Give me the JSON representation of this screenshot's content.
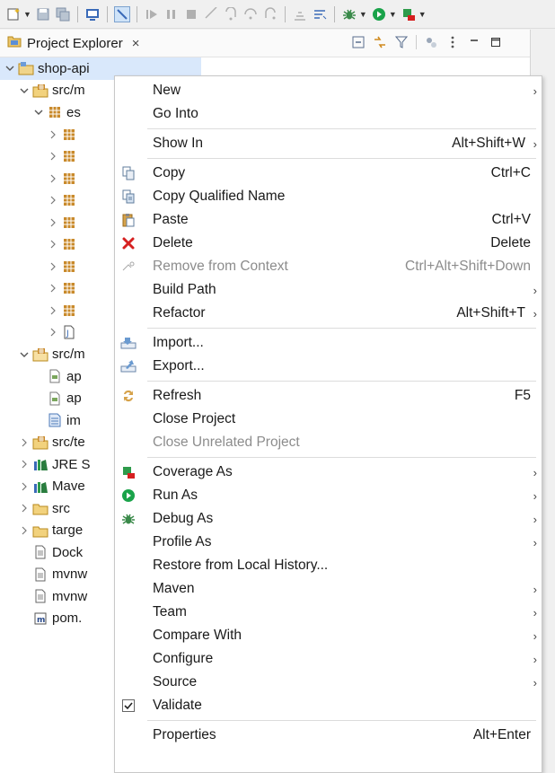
{
  "toolbar": {
    "icons": [
      "new-icon",
      "save-icon",
      "save-all-icon",
      "console-icon",
      "skip-breakpoints-icon",
      "resume-icon",
      "suspend-icon",
      "terminate-icon",
      "disconnect-icon",
      "step-into-icon",
      "step-over-icon",
      "step-return-icon",
      "drop-to-frame-icon",
      "use-step-filters-icon",
      "debug-icon",
      "run-icon",
      "coverage-icon"
    ]
  },
  "view": {
    "title": "Project Explorer",
    "close": "×"
  },
  "tree": [
    {
      "label": "shop-api",
      "twisty": "v",
      "icon": "project-icon",
      "indent": 0
    },
    {
      "label": "src/m",
      "twisty": "v",
      "icon": "source-folder-icon",
      "indent": 1
    },
    {
      "label": "es",
      "twisty": "v",
      "icon": "package-icon",
      "indent": 2
    },
    {
      "label": "",
      "twisty": ">",
      "icon": "package-icon",
      "indent": 3
    },
    {
      "label": "",
      "twisty": ">",
      "icon": "package-icon",
      "indent": 3
    },
    {
      "label": "",
      "twisty": ">",
      "icon": "package-icon",
      "indent": 3
    },
    {
      "label": "",
      "twisty": ">",
      "icon": "package-icon",
      "indent": 3
    },
    {
      "label": "",
      "twisty": ">",
      "icon": "package-icon",
      "indent": 3
    },
    {
      "label": "",
      "twisty": ">",
      "icon": "package-icon",
      "indent": 3
    },
    {
      "label": "",
      "twisty": ">",
      "icon": "package-icon",
      "indent": 3
    },
    {
      "label": "",
      "twisty": ">",
      "icon": "package-icon",
      "indent": 3
    },
    {
      "label": "",
      "twisty": ">",
      "icon": "package-icon",
      "indent": 3
    },
    {
      "label": "",
      "twisty": ">",
      "icon": "java-file-icon",
      "indent": 3
    },
    {
      "label": "src/m",
      "twisty": "v",
      "icon": "resource-folder-icon",
      "indent": 1
    },
    {
      "label": "ap",
      "twisty": "",
      "icon": "properties-file-icon",
      "indent": 2
    },
    {
      "label": "ap",
      "twisty": "",
      "icon": "properties-file-icon",
      "indent": 2
    },
    {
      "label": "im",
      "twisty": "",
      "icon": "sql-file-icon",
      "indent": 2
    },
    {
      "label": "src/te",
      "twisty": ">",
      "icon": "source-folder-icon",
      "indent": 1
    },
    {
      "label": "JRE S",
      "twisty": ">",
      "icon": "library-icon",
      "indent": 1
    },
    {
      "label": "Mave",
      "twisty": ">",
      "icon": "library-icon",
      "indent": 1
    },
    {
      "label": "src",
      "twisty": ">",
      "icon": "folder-icon",
      "indent": 1
    },
    {
      "label": "targe",
      "twisty": ">",
      "icon": "folder-icon",
      "indent": 1
    },
    {
      "label": "Dock",
      "twisty": "",
      "icon": "text-file-icon",
      "indent": 1
    },
    {
      "label": "mvnw",
      "twisty": "",
      "icon": "text-file-icon",
      "indent": 1
    },
    {
      "label": "mvnw",
      "twisty": "",
      "icon": "text-file-icon",
      "indent": 1
    },
    {
      "label": "pom.",
      "twisty": "",
      "icon": "maven-pom-icon",
      "indent": 1
    }
  ],
  "menu": {
    "items": [
      {
        "label": "New",
        "shortcut": "",
        "arrow": true,
        "icon": "",
        "disabled": false
      },
      {
        "label": "Go Into",
        "shortcut": "",
        "arrow": false,
        "icon": "",
        "disabled": false
      },
      {
        "sep": true
      },
      {
        "label": "Show In",
        "shortcut": "Alt+Shift+W",
        "arrow": true,
        "icon": "",
        "disabled": false
      },
      {
        "sep": true
      },
      {
        "label": "Copy",
        "shortcut": "Ctrl+C",
        "arrow": false,
        "icon": "copy-icon",
        "disabled": false
      },
      {
        "label": "Copy Qualified Name",
        "shortcut": "",
        "arrow": false,
        "icon": "copy-qualified-name-icon",
        "disabled": false
      },
      {
        "label": "Paste",
        "shortcut": "Ctrl+V",
        "arrow": false,
        "icon": "paste-icon",
        "disabled": false
      },
      {
        "label": "Delete",
        "shortcut": "Delete",
        "arrow": false,
        "icon": "delete-icon",
        "disabled": false
      },
      {
        "label": "Remove from Context",
        "shortcut": "Ctrl+Alt+Shift+Down",
        "arrow": false,
        "icon": "remove-from-context-icon",
        "disabled": true
      },
      {
        "label": "Build Path",
        "shortcut": "",
        "arrow": true,
        "icon": "",
        "disabled": false
      },
      {
        "label": "Refactor",
        "shortcut": "Alt+Shift+T",
        "arrow": true,
        "icon": "",
        "disabled": false
      },
      {
        "sep": true
      },
      {
        "label": "Import...",
        "shortcut": "",
        "arrow": false,
        "icon": "import-icon",
        "disabled": false
      },
      {
        "label": "Export...",
        "shortcut": "",
        "arrow": false,
        "icon": "export-icon",
        "disabled": false
      },
      {
        "sep": true
      },
      {
        "label": "Refresh",
        "shortcut": "F5",
        "arrow": false,
        "icon": "refresh-icon",
        "disabled": false
      },
      {
        "label": "Close Project",
        "shortcut": "",
        "arrow": false,
        "icon": "",
        "disabled": false
      },
      {
        "label": "Close Unrelated Project",
        "shortcut": "",
        "arrow": false,
        "icon": "",
        "disabled": true
      },
      {
        "sep": true
      },
      {
        "label": "Coverage As",
        "shortcut": "",
        "arrow": true,
        "icon": "coverage-icon",
        "disabled": false
      },
      {
        "label": "Run As",
        "shortcut": "",
        "arrow": true,
        "icon": "run-icon",
        "disabled": false
      },
      {
        "label": "Debug As",
        "shortcut": "",
        "arrow": true,
        "icon": "debug-icon",
        "disabled": false
      },
      {
        "label": "Profile As",
        "shortcut": "",
        "arrow": true,
        "icon": "",
        "disabled": false
      },
      {
        "label": "Restore from Local History...",
        "shortcut": "",
        "arrow": false,
        "icon": "",
        "disabled": false
      },
      {
        "label": "Maven",
        "shortcut": "",
        "arrow": true,
        "icon": "",
        "disabled": false
      },
      {
        "label": "Team",
        "shortcut": "",
        "arrow": true,
        "icon": "",
        "disabled": false
      },
      {
        "label": "Compare With",
        "shortcut": "",
        "arrow": true,
        "icon": "",
        "disabled": false
      },
      {
        "label": "Configure",
        "shortcut": "",
        "arrow": true,
        "icon": "",
        "disabled": false
      },
      {
        "label": "Source",
        "shortcut": "",
        "arrow": true,
        "icon": "",
        "disabled": false
      },
      {
        "label": "Validate",
        "shortcut": "",
        "arrow": false,
        "icon": "checkbox-icon",
        "disabled": false
      },
      {
        "sep": true
      },
      {
        "label": "Properties",
        "shortcut": "Alt+Enter",
        "arrow": false,
        "icon": "",
        "disabled": false
      }
    ],
    "arrow_glyph": "›"
  },
  "colors": {
    "selection": "#d9e8fb",
    "package": "#c9902b",
    "run_green": "#1aa34a",
    "delete_red": "#d62020"
  }
}
